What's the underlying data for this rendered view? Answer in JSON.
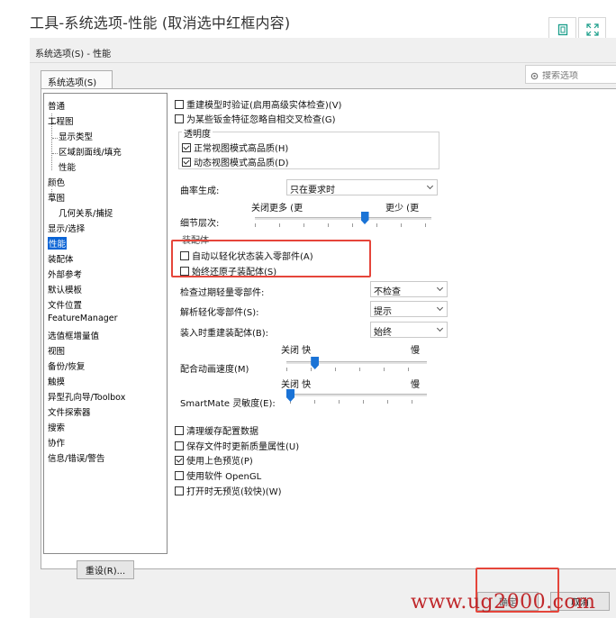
{
  "page": {
    "title": "工具-系统选项-性能 (取消选中红框内容)"
  },
  "dialog": {
    "caption": "系统选项(S) - 性能",
    "tab_label": "系统选项(S)",
    "search_placeholder": "搜索选项",
    "reset_label": "重设(R)...",
    "ok_label": "确定",
    "cancel_label": "取消"
  },
  "nav": {
    "items": [
      "普通",
      "工程图",
      "显示类型",
      "区域剖面线/填充",
      "性能",
      "颜色",
      "草图",
      "几何关系/捕捉",
      "显示/选择",
      "性能",
      "装配体",
      "外部参考",
      "默认模板",
      "文件位置",
      "FeatureManager",
      "选值框增量值",
      "视图",
      "备份/恢复",
      "触摸",
      "异型孔向导/Toolbox",
      "文件探索器",
      "搜索",
      "协作",
      "信息/错误/警告"
    ],
    "selected_index": 9
  },
  "options": {
    "rebuild_verify": {
      "label": "重建模型时验证(启用高级实体检查)(V)",
      "checked": false
    },
    "ignore_sheetmetal": {
      "label": "为某些钣金特征忽略自相交叉检查(G)",
      "checked": false
    },
    "transparency_title": "透明度",
    "normal_view_hq": {
      "label": "正常视图模式高品质(H)",
      "checked": true
    },
    "dynamic_view_hq": {
      "label": "动态视图模式高品质(D)",
      "checked": true
    },
    "curvature_label": "曲率生成:",
    "curvature_value": "只在要求时",
    "lod_more": "关闭更多 (更",
    "lod_less": "更少 (更",
    "lod_label": "细节层次:",
    "lod_level": 0.62,
    "assembly_title": "装配体",
    "auto_lightweight": {
      "label": "自动以轻化状态装入零部件(A)",
      "checked": false
    },
    "always_resolve": {
      "label": "始终还原子装配体(S)",
      "checked": false
    },
    "check_outdated_label": "检查过期轻量零部件:",
    "check_outdated_value": "不检查",
    "resolve_lightweight_label": "解析轻化零部件(S):",
    "resolve_lightweight_value": "提示",
    "rebuild_on_load_label": "装入时重建装配体(B):",
    "rebuild_on_load_value": "始终",
    "mate_anim_off_fast": "关闭 快",
    "mate_anim_slow": "慢",
    "mate_anim_label": "配合动画速度(M)",
    "mate_anim_level": 0.2,
    "smartmate_off_fast": "关闭 快",
    "smartmate_slow": "慢",
    "smartmate_label": "SmartMate 灵敏度(E):",
    "smartmate_level": 0.0,
    "purge_cache": {
      "label": "清理缓存配置数据",
      "checked": false
    },
    "save_mass_props": {
      "label": "保存文件时更新质量属性(U)",
      "checked": false
    },
    "shaded_preview": {
      "label": "使用上色预览(P)",
      "checked": true
    },
    "software_opengl": {
      "label": "使用软件 OpenGL",
      "checked": false
    },
    "no_preview_open": {
      "label": "打开时无预览(较快)(W)",
      "checked": false
    }
  },
  "watermark": "www.ug2000.com",
  "colors": {
    "highlight": "#e5453a",
    "selection": "#0a64d6",
    "slider": "#1a73d6"
  }
}
